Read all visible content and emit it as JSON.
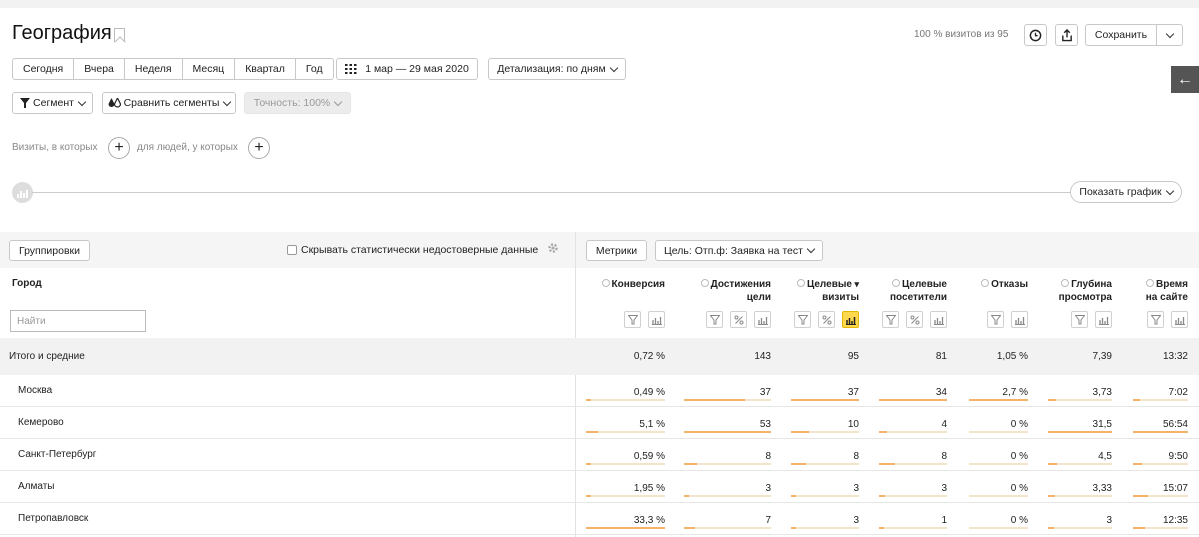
{
  "header": {
    "title": "География",
    "visits_pct": "100 % визитов из 95",
    "save_label": "Сохранить"
  },
  "period": {
    "buttons": [
      "Сегодня",
      "Вчера",
      "Неделя",
      "Месяц",
      "Квартал",
      "Год"
    ],
    "date_range": "1 мар — 29 мая 2020",
    "detail": "Детализация: по дням"
  },
  "segments": {
    "segment": "Сегмент",
    "compare": "Сравнить сегменты",
    "accuracy": "Точность: 100%"
  },
  "filters": {
    "visits_hint": "Визиты, в которых",
    "people_hint": "для людей, у которых"
  },
  "chart_toggle": "Показать график",
  "toolbar": {
    "groupings": "Группировки",
    "hide_unreliable": "Скрывать статистически недостоверные данные",
    "metrics": "Метрики",
    "goal": "Цель: Отп.ф: Заявка на тест"
  },
  "table": {
    "city_header": "Город",
    "search_placeholder": "Найти",
    "columns": [
      {
        "l1": "Конверсия",
        "l2": ""
      },
      {
        "l1": "Достижения",
        "l2": "цели"
      },
      {
        "l1": "Целевые",
        "l2": "визиты"
      },
      {
        "l1": "Целевые",
        "l2": "посетители"
      },
      {
        "l1": "Отказы",
        "l2": ""
      },
      {
        "l1": "Глубина",
        "l2": "просмотра"
      },
      {
        "l1": "Время",
        "l2": "на сайте"
      }
    ],
    "total": {
      "label": "Итого и средние",
      "values": [
        "0,72 %",
        "143",
        "95",
        "81",
        "1,05 %",
        "7,39",
        "13:32"
      ]
    },
    "rows": [
      {
        "city": "Москва",
        "values": [
          "0,49 %",
          "37",
          "37",
          "34",
          "2,7 %",
          "3,73",
          "7:02"
        ],
        "bars": [
          0.02,
          0.7,
          1.0,
          1.0,
          1.0,
          0.12,
          0.13
        ]
      },
      {
        "city": "Кемерово",
        "values": [
          "5,1 %",
          "53",
          "10",
          "4",
          "0 %",
          "31,5",
          "56:54"
        ],
        "bars": [
          0.15,
          1.0,
          0.27,
          0.12,
          0.0,
          1.0,
          1.0
        ]
      },
      {
        "city": "Санкт-Петербург",
        "values": [
          "0,59 %",
          "8",
          "8",
          "8",
          "0 %",
          "4,5",
          "9:50"
        ],
        "bars": [
          0.02,
          0.15,
          0.22,
          0.24,
          0.0,
          0.14,
          0.17
        ]
      },
      {
        "city": "Алматы",
        "values": [
          "1,95 %",
          "3",
          "3",
          "3",
          "0 %",
          "3,33",
          "15:07"
        ],
        "bars": [
          0.06,
          0.06,
          0.08,
          0.09,
          0.0,
          0.11,
          0.27
        ]
      },
      {
        "city": "Петропавловск",
        "values": [
          "33,3 %",
          "7",
          "3",
          "1",
          "0 %",
          "3",
          "12:35"
        ],
        "bars": [
          1.0,
          0.13,
          0.08,
          0.03,
          0.0,
          0.1,
          0.22
        ]
      }
    ]
  }
}
